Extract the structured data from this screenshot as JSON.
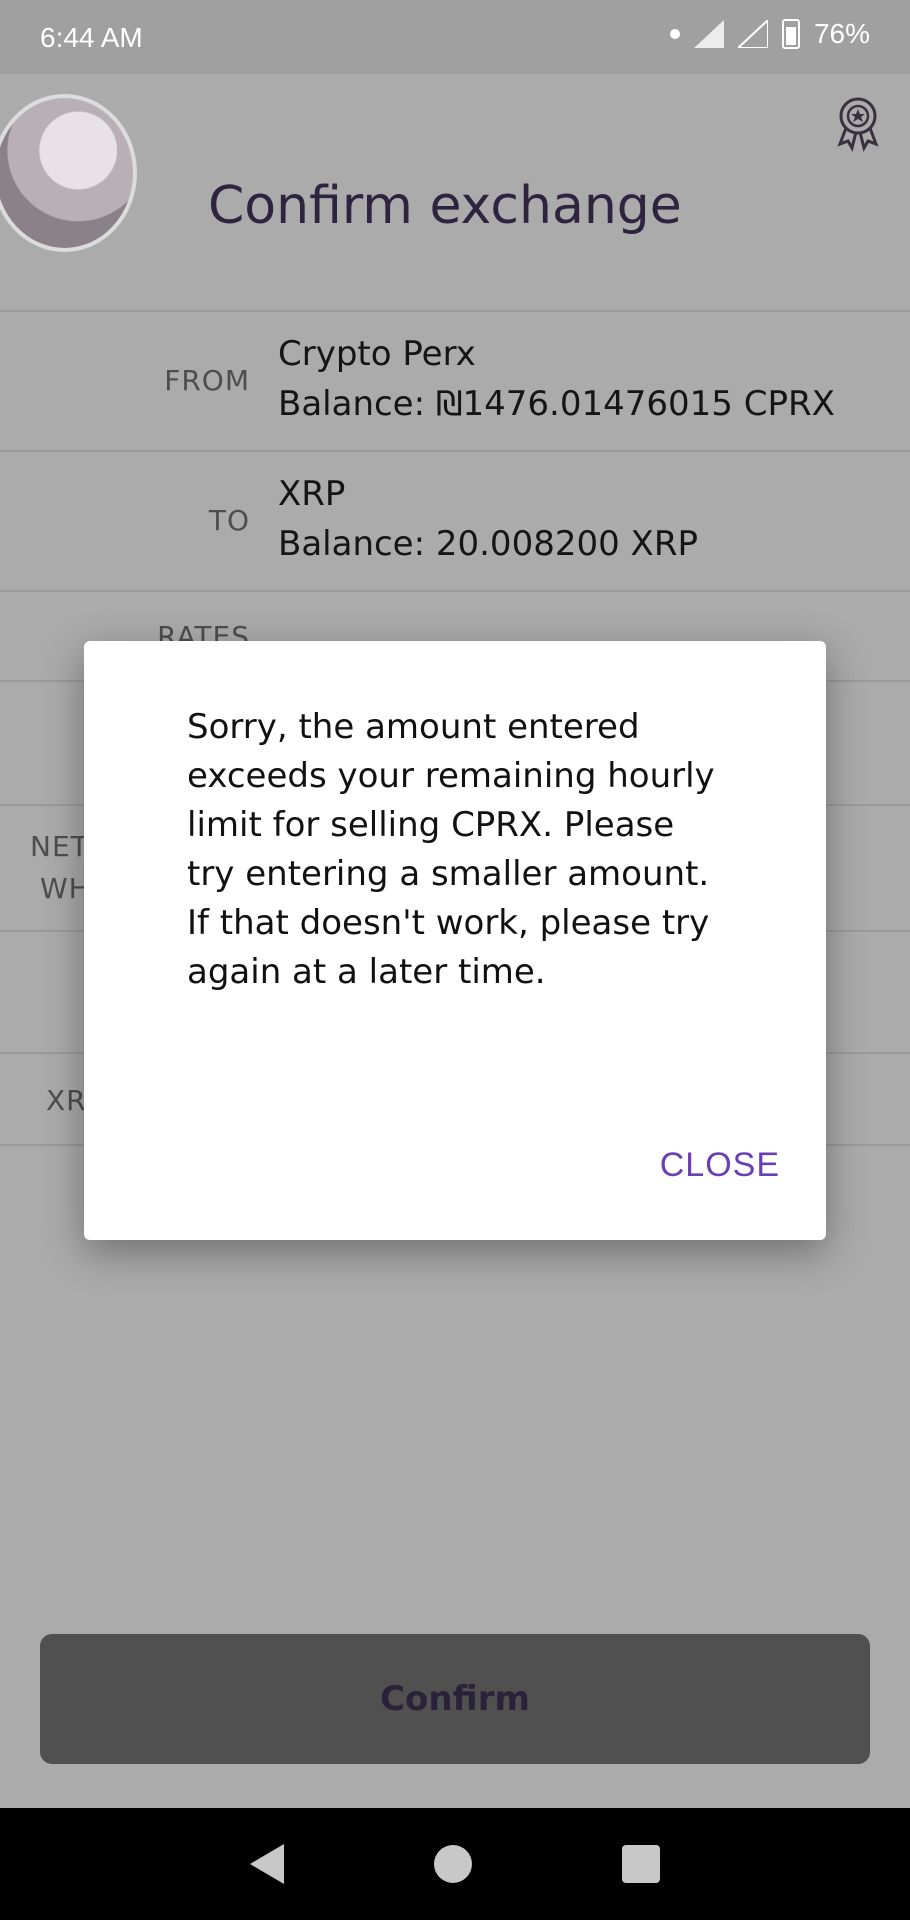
{
  "status_bar": {
    "time": "6:44 AM",
    "battery": "76%"
  },
  "header": {
    "title": "Confirm exchange",
    "avatar_icon": "user-avatar",
    "rewards_icon": "award-ribbon-icon"
  },
  "rows": [
    {
      "label": "FROM",
      "name": "Crypto Perx",
      "balance": "Balance: ₪1476.01476015 CPRX"
    },
    {
      "label": "TO",
      "name": "XRP",
      "balance": "Balance: 20.008200 XRP"
    }
  ],
  "obscured_labels": {
    "rates": "RATES",
    "net_line1": "NET",
    "net_line2": "WH",
    "xrp": "XR"
  },
  "confirm_button": {
    "label": "Confirm"
  },
  "dialog": {
    "message": "Sorry, the amount entered exceeds your remaining hourly limit for selling CPRX. Please try entering a smaller amount. If that doesn't work, please try again at a later time.",
    "close_label": "CLOSE"
  },
  "colors": {
    "accent": "#6a3fb3",
    "title": "#2e2440",
    "scrim": "#ababab"
  }
}
